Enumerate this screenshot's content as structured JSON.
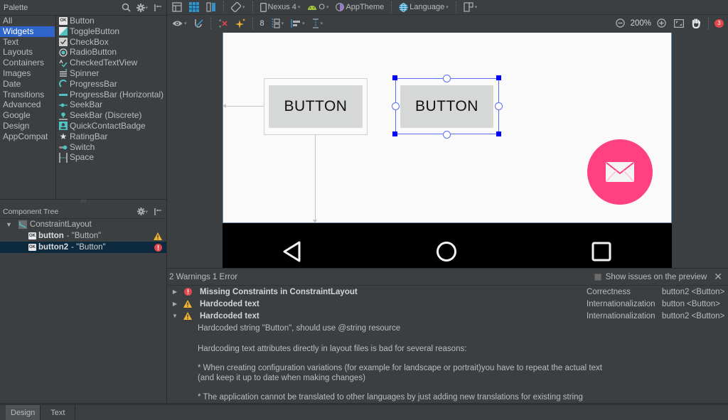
{
  "palette": {
    "title": "Palette",
    "categories": [
      "All",
      "Widgets",
      "Text",
      "Layouts",
      "Containers",
      "Images",
      "Date",
      "Transitions",
      "Advanced",
      "Google",
      "Design",
      "AppCompat"
    ],
    "selected_category": "Widgets",
    "items": [
      {
        "label": "Button",
        "icon": "ok-button-icon"
      },
      {
        "label": "ToggleButton",
        "icon": "toggle-button-icon"
      },
      {
        "label": "CheckBox",
        "icon": "checkbox-icon"
      },
      {
        "label": "RadioButton",
        "icon": "radio-button-icon"
      },
      {
        "label": "CheckedTextView",
        "icon": "checked-text-view-icon"
      },
      {
        "label": "Spinner",
        "icon": "spinner-icon"
      },
      {
        "label": "ProgressBar",
        "icon": "progress-bar-icon"
      },
      {
        "label": "ProgressBar (Horizontal)",
        "icon": "progress-bar-horizontal-icon"
      },
      {
        "label": "SeekBar",
        "icon": "seekbar-icon"
      },
      {
        "label": "SeekBar (Discrete)",
        "icon": "seekbar-discrete-icon"
      },
      {
        "label": "QuickContactBadge",
        "icon": "quick-contact-badge-icon"
      },
      {
        "label": "RatingBar",
        "icon": "star-icon"
      },
      {
        "label": "Switch",
        "icon": "switch-icon"
      },
      {
        "label": "Space",
        "icon": "space-icon"
      }
    ]
  },
  "component_tree": {
    "title": "Component Tree",
    "root": "ConstraintLayout",
    "children": [
      {
        "id": "button",
        "desc": "- \"Button\"",
        "status": "warning"
      },
      {
        "id": "button2",
        "desc": "- \"Button\"",
        "status": "error"
      }
    ]
  },
  "toolbar": {
    "device": "Nexus 4",
    "api": "O",
    "theme": "AppTheme",
    "language": "Language",
    "margin": "8",
    "zoom": "200%",
    "issue_count": "3"
  },
  "preview": {
    "button1_label": "BUTTON",
    "button2_label": "BUTTON",
    "fab_color": "#ff4081",
    "selection_color": "#0000ff"
  },
  "issues": {
    "summary": "2 Warnings 1 Error",
    "show_on_preview_label": "Show issues on the preview",
    "rows": [
      {
        "title": "Missing Constraints in ConstraintLayout",
        "category": "Correctness",
        "component": "button2 <Button>",
        "severity": "error",
        "expanded": false
      },
      {
        "title": "Hardcoded text",
        "category": "Internationalization",
        "component": "button <Button>",
        "severity": "warning",
        "expanded": false
      },
      {
        "title": "Hardcoded text",
        "category": "Internationalization",
        "component": "button2 <Button>",
        "severity": "warning",
        "expanded": true
      }
    ],
    "detail": [
      "Hardcoded string \"Button\", should use @string resource",
      "Hardcoding text attributes directly in layout files is bad for several reasons:",
      "* When creating configuration variations (for example for landscape or portrait)you have to repeat the actual text",
      "(and keep it up to date when making changes)",
      "* The application cannot be translated to other languages by just adding new translations for existing string"
    ]
  },
  "bottom_tabs": [
    {
      "label": "Design",
      "selected": true
    },
    {
      "label": "Text",
      "selected": false
    }
  ]
}
